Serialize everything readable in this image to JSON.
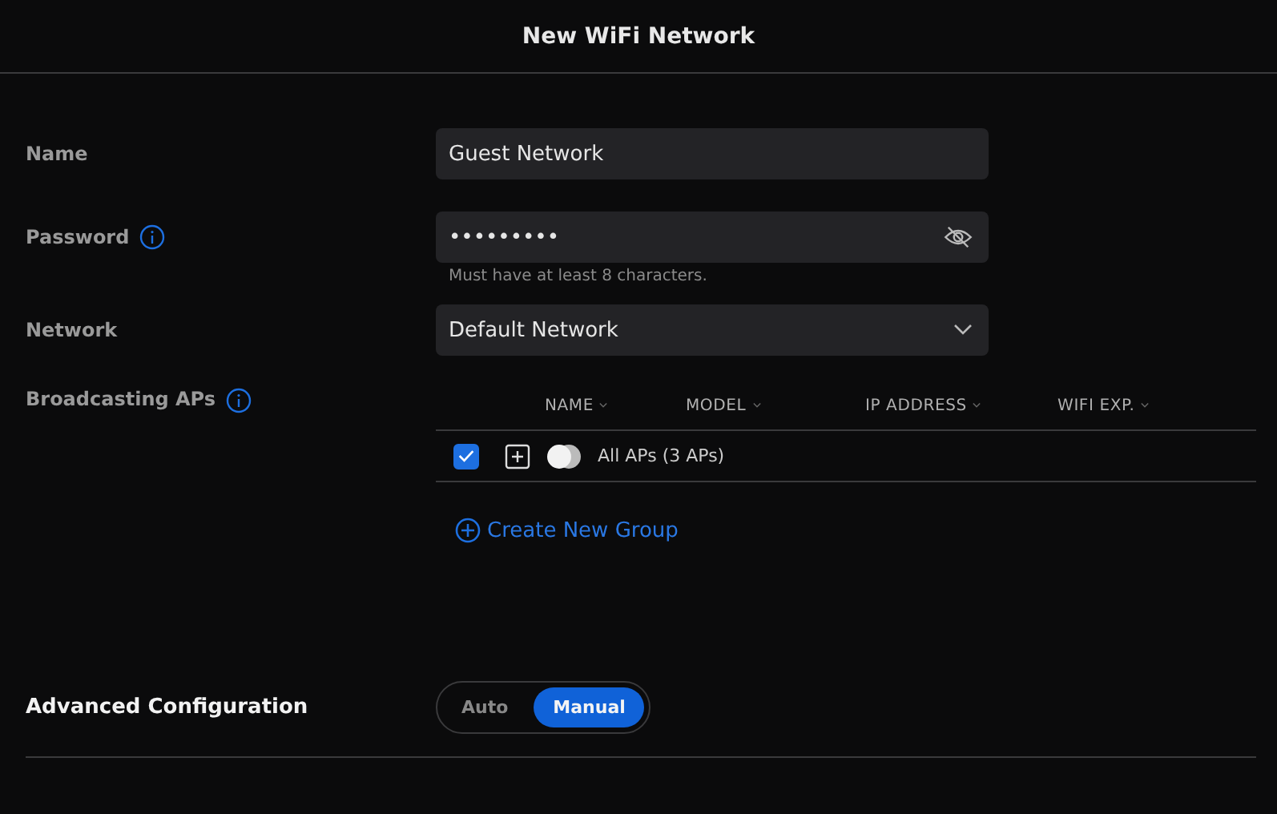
{
  "window": {
    "title": "New WiFi Network"
  },
  "fields": [
    {
      "kind": "text",
      "label": "Name",
      "info": false,
      "value": "Guest Network"
    },
    {
      "kind": "password",
      "label": "Password",
      "info": true,
      "value": "•••••••••",
      "hint": "Must have at least 8 characters."
    },
    {
      "kind": "select",
      "label": "Network",
      "info": false,
      "value": "Default Network"
    }
  ],
  "broadcasting": {
    "label": "Broadcasting APs",
    "info": true,
    "columns": [
      "NAME",
      "MODEL",
      "IP ADDRESS",
      "WIFI EXP."
    ],
    "rows": [
      {
        "checked": true,
        "name": "All APs (3 APs)"
      }
    ],
    "create_link": "Create New Group"
  },
  "advanced": {
    "label": "Advanced Configuration",
    "options": [
      {
        "label": "Auto",
        "selected": false
      },
      {
        "label": "Manual",
        "selected": true
      }
    ]
  }
}
